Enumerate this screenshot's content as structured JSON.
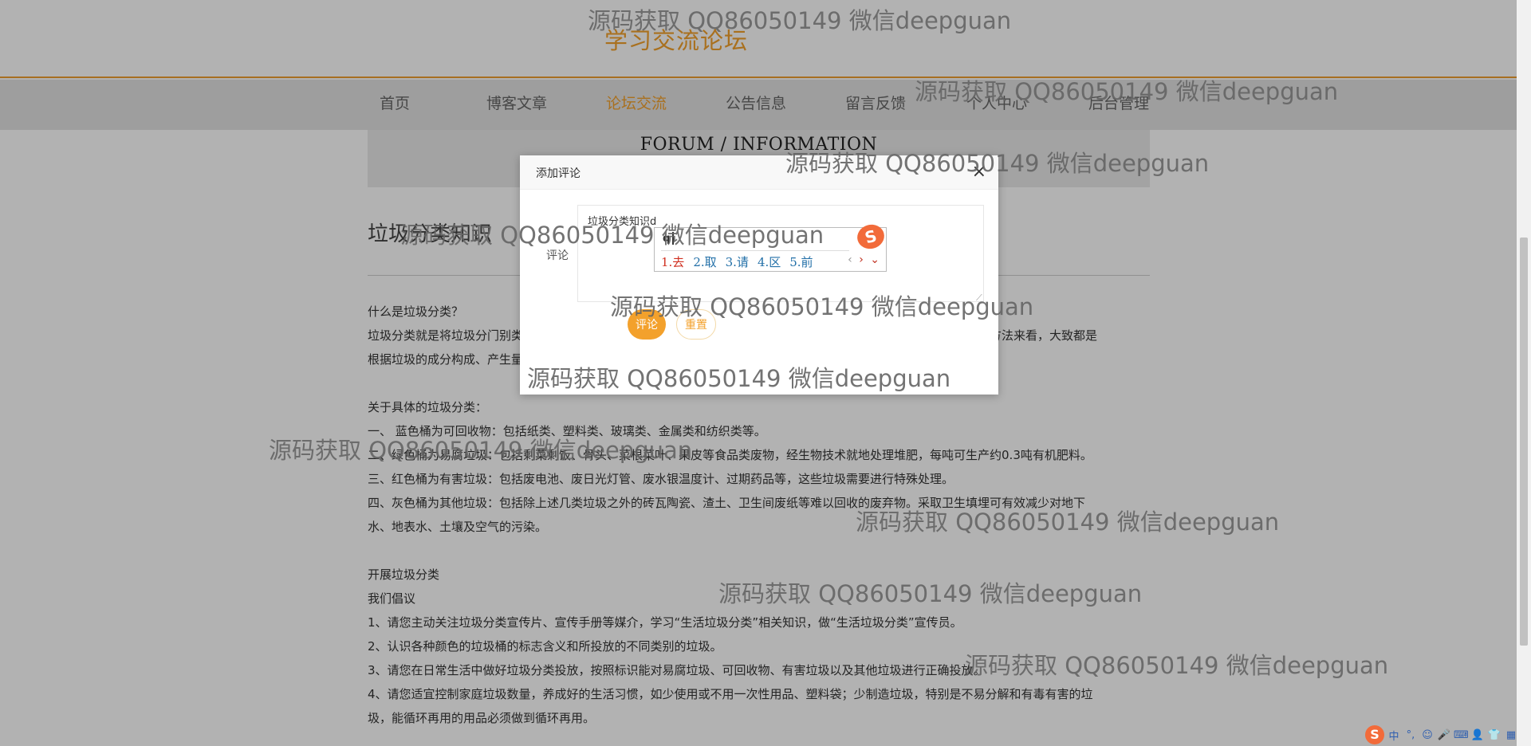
{
  "header": {
    "site_title": "学习交流论坛"
  },
  "nav": {
    "items": [
      {
        "label": "首页"
      },
      {
        "label": "博客文章"
      },
      {
        "label": "论坛交流"
      },
      {
        "label": "公告信息"
      },
      {
        "label": "留言反馈"
      },
      {
        "label": "个人中心"
      },
      {
        "label": "后台管理"
      }
    ],
    "active_index": 2
  },
  "banner": {
    "text": "FORUM / INFORMATION"
  },
  "post": {
    "title": "垃圾分类知识"
  },
  "article": {
    "lines": [
      "什么是垃圾分类？",
      "垃圾分类就是将垃圾分门别类地投放，并通过分类的清运和回收使之重新变成资源。从国内外各城市对生活垃圾分类的方法来看，大致都是",
      "根据垃圾的成分构成、产生量，结合本地垃圾的资源利用和处理方式来进行分类。",
      "",
      "关于具体的垃圾分类：",
      "一、 蓝色桶为可回收物：包括纸类、塑料类、玻璃类、金属类和纺织类等。",
      "二、绿色桶为易腐垃圾：包括剩菜剩饭、骨头、菜根菜叶、果皮等食品类废物，经生物技术就地处理堆肥，每吨可生产约0.3吨有机肥料。",
      "三、红色桶为有害垃圾：包括废电池、废日光灯管、废水银温度计、过期药品等，这些垃圾需要进行特殊处理。",
      "四、灰色桶为其他垃圾：包括除上述几类垃圾之外的砖瓦陶瓷、渣土、卫生间废纸等难以回收的废弃物。采取卫生填埋可有效减少对地下",
      "水、地表水、土壤及空气的污染。",
      "",
      "开展垃圾分类",
      "我们倡议",
      "1、请您主动关注垃圾分类宣传片、宣传手册等媒介，学习“生活垃圾分类”相关知识，做“生活垃圾分类”宣传员。",
      "2、认识各种颜色的垃圾桶的标志含义和所投放的不同类别的垃圾。",
      "3、请您在日常生活中做好垃圾分类投放，按照标识能对易腐垃圾、可回收物、有害垃圾以及其他垃圾进行正确投放。",
      "4、请您适宜控制家庭垃圾数量，养成好的生活习惯，如少使用或不用一次性用品、塑料袋；少制造垃圾，特别是不易分解和有毒有害的垃",
      "圾，能循环再用的用品必须做到循环再用。"
    ]
  },
  "modal": {
    "title": "添加评论",
    "close_icon": "×",
    "field_label": "评论",
    "comment_value": "垃圾分类知识d",
    "submit_label": "评论",
    "reset_label": "重置"
  },
  "ime": {
    "input": "q",
    "logo": "S",
    "candidates": [
      "1.去",
      "2.取",
      "3.请",
      "4.区",
      "5.前"
    ],
    "nav": [
      "‹",
      "›",
      "⌄"
    ]
  },
  "tray": {
    "logo": "S",
    "items": [
      "中",
      "°,",
      "☺",
      "🎤",
      "⌨",
      "👤",
      "👕",
      "▦"
    ]
  },
  "watermark": {
    "text": "源码获取 QQ86050149 微信deepguan"
  },
  "colors": {
    "accent": "#f3a12c",
    "overlay": "rgba(0,0,0,0.3)",
    "ime_logo": "#f26b3a"
  }
}
